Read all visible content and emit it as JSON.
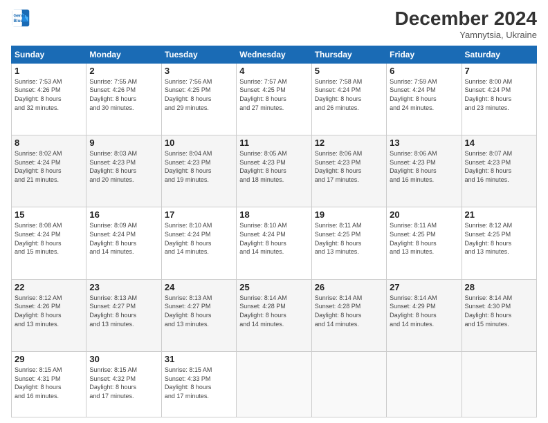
{
  "header": {
    "logo_line1": "General",
    "logo_line2": "Blue",
    "month": "December 2024",
    "location": "Yamnytsia, Ukraine"
  },
  "days_of_week": [
    "Sunday",
    "Monday",
    "Tuesday",
    "Wednesday",
    "Thursday",
    "Friday",
    "Saturday"
  ],
  "weeks": [
    [
      {
        "day": "1",
        "info": "Sunrise: 7:53 AM\nSunset: 4:26 PM\nDaylight: 8 hours\nand 32 minutes."
      },
      {
        "day": "2",
        "info": "Sunrise: 7:55 AM\nSunset: 4:26 PM\nDaylight: 8 hours\nand 30 minutes."
      },
      {
        "day": "3",
        "info": "Sunrise: 7:56 AM\nSunset: 4:25 PM\nDaylight: 8 hours\nand 29 minutes."
      },
      {
        "day": "4",
        "info": "Sunrise: 7:57 AM\nSunset: 4:25 PM\nDaylight: 8 hours\nand 27 minutes."
      },
      {
        "day": "5",
        "info": "Sunrise: 7:58 AM\nSunset: 4:24 PM\nDaylight: 8 hours\nand 26 minutes."
      },
      {
        "day": "6",
        "info": "Sunrise: 7:59 AM\nSunset: 4:24 PM\nDaylight: 8 hours\nand 24 minutes."
      },
      {
        "day": "7",
        "info": "Sunrise: 8:00 AM\nSunset: 4:24 PM\nDaylight: 8 hours\nand 23 minutes."
      }
    ],
    [
      {
        "day": "8",
        "info": "Sunrise: 8:02 AM\nSunset: 4:24 PM\nDaylight: 8 hours\nand 21 minutes."
      },
      {
        "day": "9",
        "info": "Sunrise: 8:03 AM\nSunset: 4:23 PM\nDaylight: 8 hours\nand 20 minutes."
      },
      {
        "day": "10",
        "info": "Sunrise: 8:04 AM\nSunset: 4:23 PM\nDaylight: 8 hours\nand 19 minutes."
      },
      {
        "day": "11",
        "info": "Sunrise: 8:05 AM\nSunset: 4:23 PM\nDaylight: 8 hours\nand 18 minutes."
      },
      {
        "day": "12",
        "info": "Sunrise: 8:06 AM\nSunset: 4:23 PM\nDaylight: 8 hours\nand 17 minutes."
      },
      {
        "day": "13",
        "info": "Sunrise: 8:06 AM\nSunset: 4:23 PM\nDaylight: 8 hours\nand 16 minutes."
      },
      {
        "day": "14",
        "info": "Sunrise: 8:07 AM\nSunset: 4:23 PM\nDaylight: 8 hours\nand 16 minutes."
      }
    ],
    [
      {
        "day": "15",
        "info": "Sunrise: 8:08 AM\nSunset: 4:24 PM\nDaylight: 8 hours\nand 15 minutes."
      },
      {
        "day": "16",
        "info": "Sunrise: 8:09 AM\nSunset: 4:24 PM\nDaylight: 8 hours\nand 14 minutes."
      },
      {
        "day": "17",
        "info": "Sunrise: 8:10 AM\nSunset: 4:24 PM\nDaylight: 8 hours\nand 14 minutes."
      },
      {
        "day": "18",
        "info": "Sunrise: 8:10 AM\nSunset: 4:24 PM\nDaylight: 8 hours\nand 14 minutes."
      },
      {
        "day": "19",
        "info": "Sunrise: 8:11 AM\nSunset: 4:25 PM\nDaylight: 8 hours\nand 13 minutes."
      },
      {
        "day": "20",
        "info": "Sunrise: 8:11 AM\nSunset: 4:25 PM\nDaylight: 8 hours\nand 13 minutes."
      },
      {
        "day": "21",
        "info": "Sunrise: 8:12 AM\nSunset: 4:25 PM\nDaylight: 8 hours\nand 13 minutes."
      }
    ],
    [
      {
        "day": "22",
        "info": "Sunrise: 8:12 AM\nSunset: 4:26 PM\nDaylight: 8 hours\nand 13 minutes."
      },
      {
        "day": "23",
        "info": "Sunrise: 8:13 AM\nSunset: 4:27 PM\nDaylight: 8 hours\nand 13 minutes."
      },
      {
        "day": "24",
        "info": "Sunrise: 8:13 AM\nSunset: 4:27 PM\nDaylight: 8 hours\nand 13 minutes."
      },
      {
        "day": "25",
        "info": "Sunrise: 8:14 AM\nSunset: 4:28 PM\nDaylight: 8 hours\nand 14 minutes."
      },
      {
        "day": "26",
        "info": "Sunrise: 8:14 AM\nSunset: 4:28 PM\nDaylight: 8 hours\nand 14 minutes."
      },
      {
        "day": "27",
        "info": "Sunrise: 8:14 AM\nSunset: 4:29 PM\nDaylight: 8 hours\nand 14 minutes."
      },
      {
        "day": "28",
        "info": "Sunrise: 8:14 AM\nSunset: 4:30 PM\nDaylight: 8 hours\nand 15 minutes."
      }
    ],
    [
      {
        "day": "29",
        "info": "Sunrise: 8:15 AM\nSunset: 4:31 PM\nDaylight: 8 hours\nand 16 minutes."
      },
      {
        "day": "30",
        "info": "Sunrise: 8:15 AM\nSunset: 4:32 PM\nDaylight: 8 hours\nand 17 minutes."
      },
      {
        "day": "31",
        "info": "Sunrise: 8:15 AM\nSunset: 4:33 PM\nDaylight: 8 hours\nand 17 minutes."
      },
      null,
      null,
      null,
      null
    ]
  ]
}
